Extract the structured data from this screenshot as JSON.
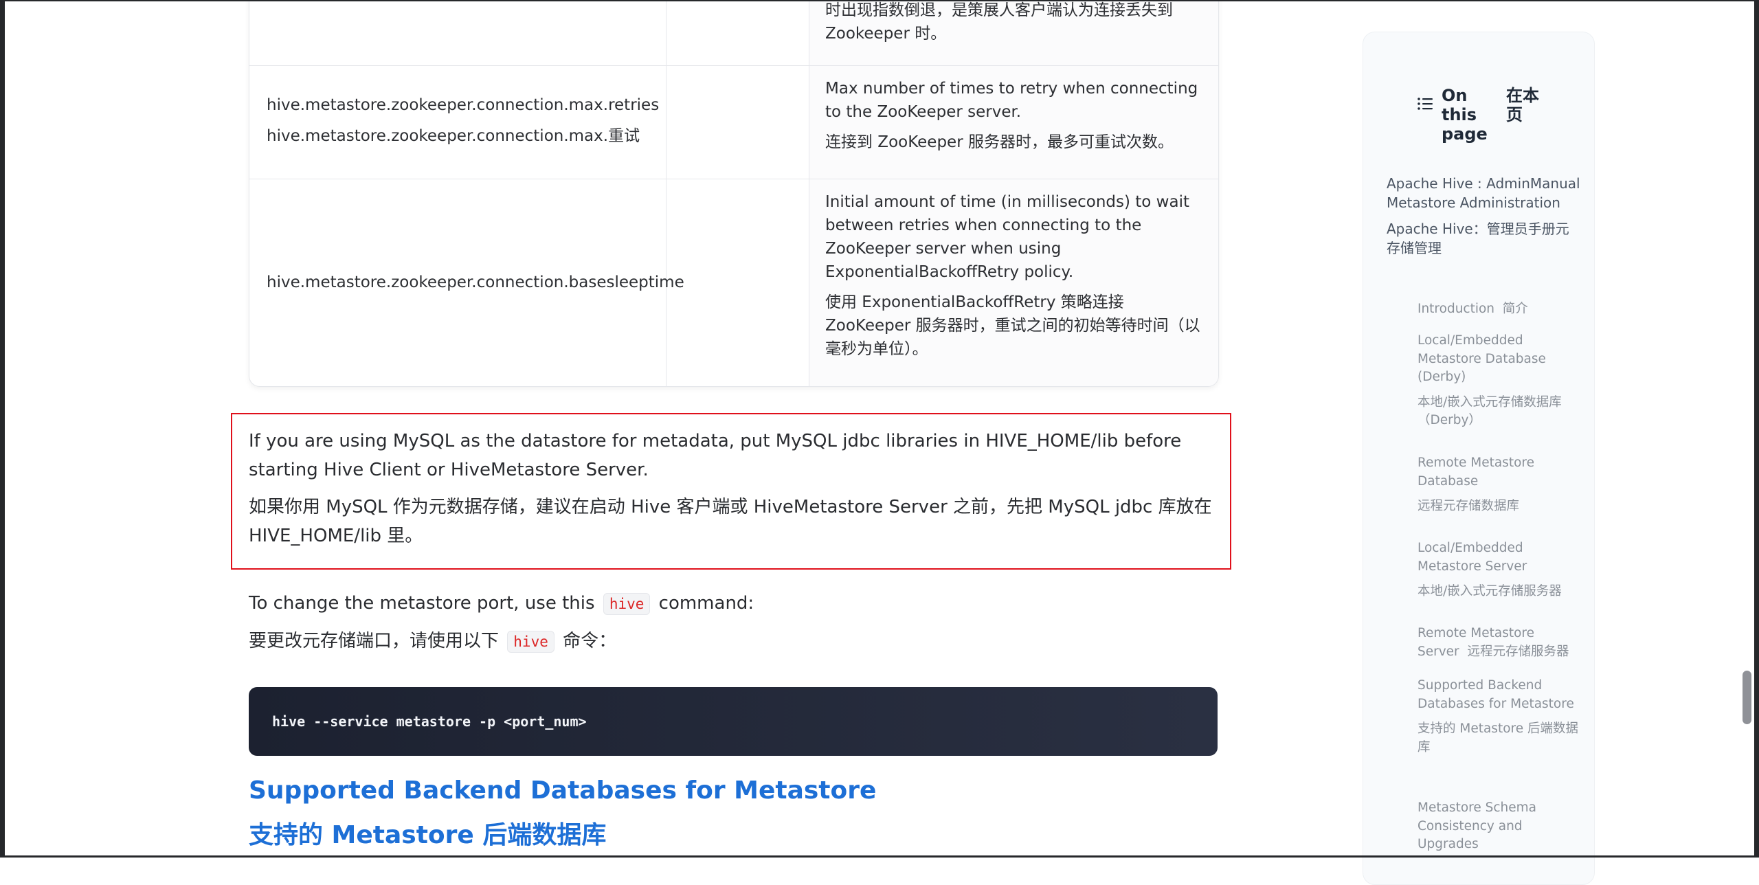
{
  "table": {
    "rows": [
      {
        "name_lines": [],
        "desc_en": "",
        "desc_zh": "时出现指数倒退，是策展人客户端认为连接丢失到 Zookeeper 时。"
      },
      {
        "name_lines": [
          "hive.metastore.zookeeper.connection.max.retries",
          "hive.metastore.zookeeper.connection.max.重试"
        ],
        "desc_en": "Max number of times to retry when connecting to the ZooKeeper server.",
        "desc_zh": "连接到 ZooKeeper 服务器时，最多可重试次数。"
      },
      {
        "name_lines": [
          "hive.metastore.zookeeper.connection.basesleeptime"
        ],
        "desc_en": "Initial amount of time (in milliseconds) to wait between retries when connecting to the ZooKeeper server when using ExponentialBackoffRetry policy.",
        "desc_zh": "使用 ExponentialBackoffRetry 策略连接 ZooKeeper 服务器时，重试之间的初始等待时间（以毫秒为单位）。"
      }
    ]
  },
  "notice": {
    "en": "If you are using MySQL as the datastore for metadata, put MySQL jdbc libraries in HIVE_HOME/lib before starting Hive Client or HiveMetastore Server.",
    "zh": "如果你用 MySQL 作为元数据存储，建议在启动 Hive 客户端或 HiveMetastore Server 之前，先把 MySQL jdbc 库放在 HIVE_HOME/lib 里。"
  },
  "port_text": {
    "en_before": "To change the metastore port, use this",
    "en_code": "hive",
    "en_after": "command:",
    "zh_before": "要更改元存储端口，请使用以下",
    "zh_code": "hive",
    "zh_after": "命令："
  },
  "code_block": "hive --service metastore -p <port_num>",
  "section": {
    "title_en": "Supported Backend Databases for Metastore",
    "title_zh": "支持的 Metastore 后端数据库"
  },
  "toc": {
    "title_en": "On this page",
    "title_zh": "在本页",
    "top_items": [
      {
        "en": "Apache Hive : AdminManual Metastore Administration",
        "zh": "Apache Hive：管理员手册元存储管理"
      }
    ],
    "sub_items": [
      {
        "en": "Introduction",
        "zh": "简介"
      },
      {
        "en": "Local/Embedded Metastore Database (Derby)",
        "zh": "本地/嵌入式元存储数据库（Derby）"
      },
      {
        "en": "Remote Metastore Database",
        "zh": "远程元存储数据库"
      },
      {
        "en": "Local/Embedded Metastore Server",
        "zh": "本地/嵌入式元存储服务器"
      },
      {
        "en": "Remote Metastore Server",
        "zh": "远程元存储服务器"
      },
      {
        "en": "Supported Backend Databases for Metastore",
        "zh": "支持的 Metastore 后端数据库"
      },
      {
        "en": "Metastore Schema Consistency and Upgrades",
        "zh": ""
      }
    ]
  },
  "icons": {
    "toc": "list-icon"
  },
  "colors": {
    "heading": "#1d6fd6",
    "notice_border": "#e0101b",
    "inline_code": "#dc2626",
    "code_bg": "#1c2130"
  }
}
